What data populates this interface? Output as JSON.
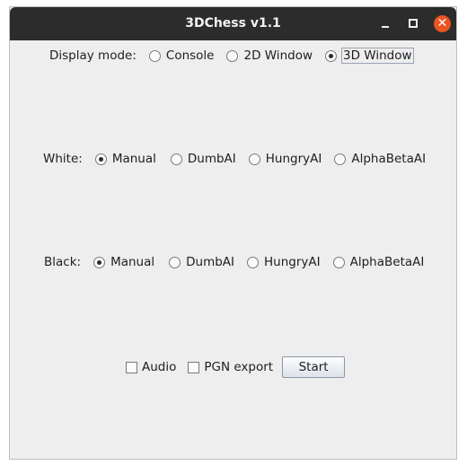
{
  "window": {
    "title": "3DChess v1.1",
    "close_glyph": "✕"
  },
  "display": {
    "label": "Display mode:",
    "options": [
      "Console",
      "2D Window",
      "3D Window"
    ],
    "selected": "3D Window"
  },
  "white": {
    "label": "White:",
    "options": [
      "Manual",
      "DumbAI",
      "HungryAI",
      "AlphaBetaAI"
    ],
    "selected": "Manual"
  },
  "black": {
    "label": "Black:",
    "options": [
      "Manual",
      "DumbAI",
      "HungryAI",
      "AlphaBetaAI"
    ],
    "selected": "Manual"
  },
  "controls": {
    "audio_label": "Audio",
    "pgn_label": "PGN export",
    "start_label": "Start"
  }
}
